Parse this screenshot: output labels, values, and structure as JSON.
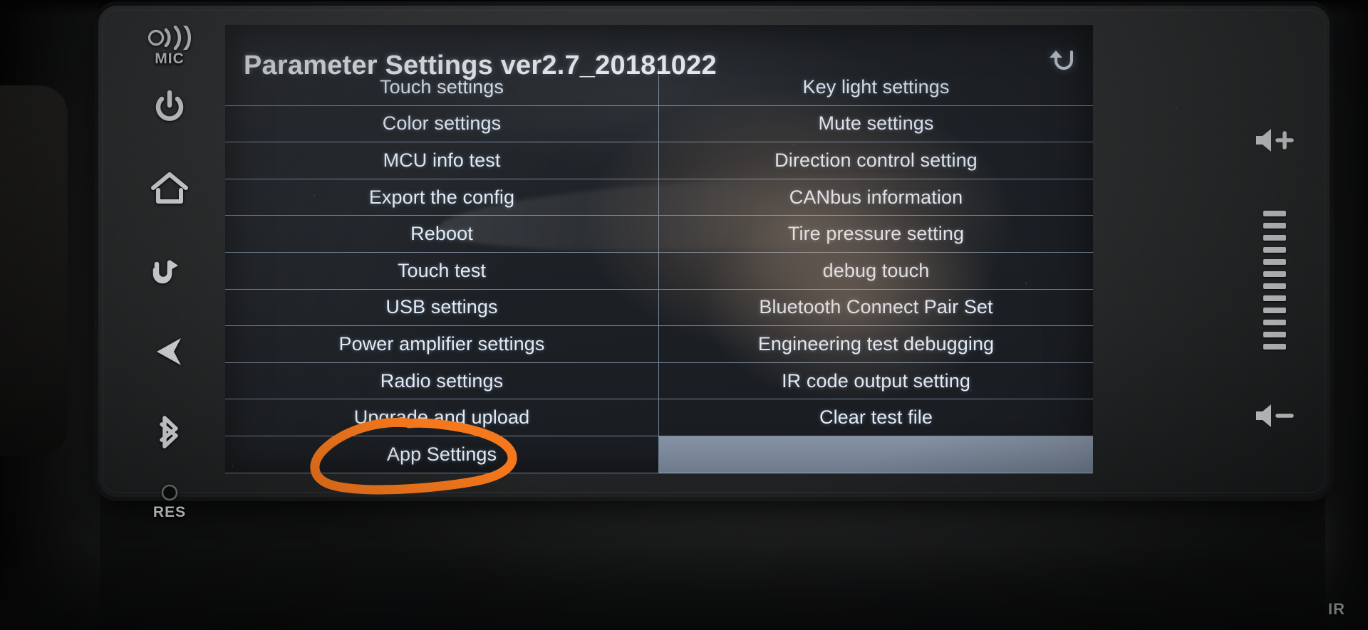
{
  "device": {
    "title": "Parameter Settings ver2.7_20181022",
    "back_icon": "back-arrow-icon"
  },
  "bezel_left": {
    "buttons": [
      {
        "name": "mic",
        "label": "MIC",
        "icon": "microphone-icon"
      },
      {
        "name": "power",
        "label": "",
        "icon": "power-icon"
      },
      {
        "name": "home",
        "label": "",
        "icon": "home-icon"
      },
      {
        "name": "return",
        "label": "",
        "icon": "return-arrow-icon"
      },
      {
        "name": "navigation",
        "label": "",
        "icon": "navigation-arrow-icon"
      },
      {
        "name": "bluetooth",
        "label": "",
        "icon": "bluetooth-icon"
      },
      {
        "name": "reset",
        "label": "RES",
        "icon": "reset-pinhole-icon"
      }
    ]
  },
  "bezel_right": {
    "volume_up": "volume-up-icon",
    "volume_down": "volume-down-icon",
    "ladder_rungs": 12,
    "ir_label": "IR"
  },
  "menu": {
    "columns": [
      {
        "name": "left-column",
        "items": [
          "Touch settings",
          "Color settings",
          "MCU info test",
          "Export the config",
          "Reboot",
          "Touch test",
          "USB settings",
          "Power amplifier settings",
          "Radio settings",
          "Upgrade and upload",
          "App Settings"
        ]
      },
      {
        "name": "right-column",
        "items": [
          "Key light settings",
          "Mute settings",
          "Direction control setting",
          "CANbus information",
          "Tire pressure setting",
          "debug touch",
          "Bluetooth Connect Pair Set",
          "Engineering test debugging",
          "IR code output setting",
          "Clear test file",
          ""
        ]
      }
    ],
    "highlighted_cell": {
      "column": 1,
      "row": 10
    },
    "annotated_cell": {
      "column": 0,
      "row": 10,
      "label": "App Settings"
    }
  },
  "annotation": {
    "type": "hand-drawn-circle",
    "color": "#F5781C",
    "targets": "App Settings"
  },
  "colors": {
    "screen_text": "#E3EAF3",
    "grid_line": "#ACC4E2",
    "highlight_row": "#B0C0D6",
    "annotation_orange": "#F5781C",
    "bezel": "#303233"
  }
}
